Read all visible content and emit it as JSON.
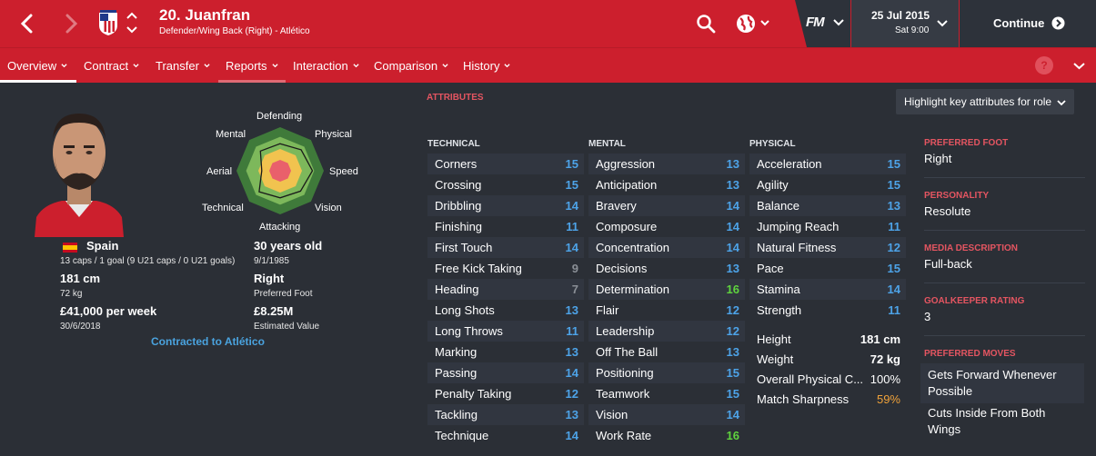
{
  "header": {
    "player_title": "20. Juanfran",
    "player_subtitle": "Defender/Wing Back (Right) - Atlético",
    "fm_logo": "FM",
    "date": "25 Jul 2015",
    "time": "Sat 9:00",
    "continue_label": "Continue",
    "icons": [
      "back-icon",
      "forward-icon",
      "club-crest-icon",
      "up-down-icon",
      "search-icon",
      "globe-icon",
      "chevron-down-icon",
      "continue-arrow-icon"
    ]
  },
  "subnav": {
    "items": [
      {
        "label": "Overview"
      },
      {
        "label": "Contract"
      },
      {
        "label": "Transfer"
      },
      {
        "label": "Reports"
      },
      {
        "label": "Interaction"
      },
      {
        "label": "Comparison"
      },
      {
        "label": "History"
      }
    ],
    "help": "?"
  },
  "profile": {
    "nation": "Spain",
    "caps": "13 caps / 1 goal (9 U21 caps / 0 U21 goals)",
    "height": "181 cm",
    "weight": "72 kg",
    "wage": "£41,000 per week",
    "contract_end": "30/6/2018",
    "age": "30 years old",
    "dob": "9/1/1985",
    "foot": "Right",
    "foot_label": "Preferred Foot",
    "value": "£8.25M",
    "value_label": "Estimated Value",
    "contracted": "Contracted to Atlético"
  },
  "radar": {
    "labels": [
      "Defending",
      "Physical",
      "Speed",
      "Vision",
      "Attacking",
      "Technical",
      "Aerial",
      "Mental"
    ],
    "colors": {
      "outer": "#3f7a3a",
      "mid": "#7db85b",
      "inner": "#f1c34f",
      "core": "#e9606b"
    }
  },
  "attributes": {
    "section_title": "ATTRIBUTES",
    "highlight_label": "Highlight key attributes for role",
    "technical_title": "TECHNICAL",
    "mental_title": "MENTAL",
    "physical_title": "PHYSICAL",
    "technical": [
      {
        "name": "Corners",
        "value": "15",
        "color": "#4da3e8"
      },
      {
        "name": "Crossing",
        "value": "15",
        "color": "#4da3e8"
      },
      {
        "name": "Dribbling",
        "value": "14",
        "color": "#4da3e8"
      },
      {
        "name": "Finishing",
        "value": "11",
        "color": "#4da3e8"
      },
      {
        "name": "First Touch",
        "value": "14",
        "color": "#4da3e8"
      },
      {
        "name": "Free Kick Taking",
        "value": "9",
        "color": "#8a8f96"
      },
      {
        "name": "Heading",
        "value": "7",
        "color": "#8a8f96"
      },
      {
        "name": "Long Shots",
        "value": "13",
        "color": "#4da3e8"
      },
      {
        "name": "Long Throws",
        "value": "11",
        "color": "#4da3e8"
      },
      {
        "name": "Marking",
        "value": "13",
        "color": "#4da3e8"
      },
      {
        "name": "Passing",
        "value": "14",
        "color": "#4da3e8"
      },
      {
        "name": "Penalty Taking",
        "value": "12",
        "color": "#4da3e8"
      },
      {
        "name": "Tackling",
        "value": "13",
        "color": "#4da3e8"
      },
      {
        "name": "Technique",
        "value": "14",
        "color": "#4da3e8"
      }
    ],
    "mental": [
      {
        "name": "Aggression",
        "value": "13",
        "color": "#4da3e8"
      },
      {
        "name": "Anticipation",
        "value": "13",
        "color": "#4da3e8"
      },
      {
        "name": "Bravery",
        "value": "14",
        "color": "#4da3e8"
      },
      {
        "name": "Composure",
        "value": "14",
        "color": "#4da3e8"
      },
      {
        "name": "Concentration",
        "value": "14",
        "color": "#4da3e8"
      },
      {
        "name": "Decisions",
        "value": "13",
        "color": "#4da3e8"
      },
      {
        "name": "Determination",
        "value": "16",
        "color": "#5fd33e"
      },
      {
        "name": "Flair",
        "value": "12",
        "color": "#4da3e8"
      },
      {
        "name": "Leadership",
        "value": "12",
        "color": "#4da3e8"
      },
      {
        "name": "Off The Ball",
        "value": "13",
        "color": "#4da3e8"
      },
      {
        "name": "Positioning",
        "value": "15",
        "color": "#4da3e8"
      },
      {
        "name": "Teamwork",
        "value": "15",
        "color": "#4da3e8"
      },
      {
        "name": "Vision",
        "value": "14",
        "color": "#4da3e8"
      },
      {
        "name": "Work Rate",
        "value": "16",
        "color": "#5fd33e"
      }
    ],
    "physical": [
      {
        "name": "Acceleration",
        "value": "15",
        "color": "#4da3e8"
      },
      {
        "name": "Agility",
        "value": "15",
        "color": "#4da3e8"
      },
      {
        "name": "Balance",
        "value": "13",
        "color": "#4da3e8"
      },
      {
        "name": "Jumping Reach",
        "value": "11",
        "color": "#4da3e8"
      },
      {
        "name": "Natural Fitness",
        "value": "12",
        "color": "#4da3e8"
      },
      {
        "name": "Pace",
        "value": "15",
        "color": "#4da3e8"
      },
      {
        "name": "Stamina",
        "value": "14",
        "color": "#4da3e8"
      },
      {
        "name": "Strength",
        "value": "11",
        "color": "#4da3e8"
      }
    ],
    "physical_extra": [
      {
        "name": "Height",
        "value": "181 cm",
        "color": "#ffffff"
      },
      {
        "name": "Weight",
        "value": "72 kg",
        "color": "#ffffff"
      },
      {
        "name": "Overall Physical C...",
        "value": "100%",
        "color": "#ffffff"
      },
      {
        "name": "Match Sharpness",
        "value": "59%",
        "color": "#f0a23a"
      }
    ]
  },
  "side": {
    "preferred_foot_label": "PREFERRED FOOT",
    "preferred_foot": "Right",
    "personality_label": "PERSONALITY",
    "personality": "Resolute",
    "media_label": "MEDIA DESCRIPTION",
    "media": "Full-back",
    "gk_label": "GOALKEEPER RATING",
    "gk": "3",
    "moves_label": "PREFERRED MOVES",
    "moves": [
      "Gets Forward Whenever Possible",
      "Cuts Inside From Both Wings"
    ]
  }
}
